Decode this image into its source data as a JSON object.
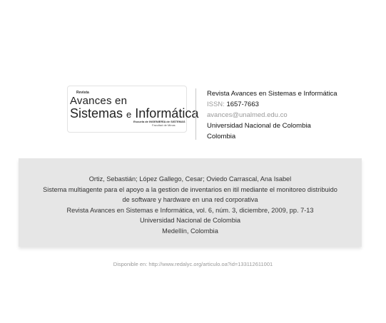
{
  "logo": {
    "small": "Revista",
    "line1": "Avances en",
    "line2_main": "Sistemas",
    "line2_e": "e",
    "line2_end": "Informática",
    "school": "Escuela de INGENIERÍA de SISTEMAS",
    "faculty": "Facultad de Minas"
  },
  "journal": {
    "name": "Revista Avances en Sistemas e Informática",
    "issn_label": "ISSN:",
    "issn": "1657-7663",
    "email": "avances@unalmed.edu.co",
    "institution": "Universidad Nacional de Colombia",
    "country": "Colombia"
  },
  "reference": {
    "authors": "Ortiz, Sebastián; López Gallego, Cesar; Oviedo Carrascal, Ana Isabel",
    "title_line1": "Sistema multiagente para el apoyo a la gestion de inventarios en itil mediante el monitoreo distribuido",
    "title_line2": "de software y hardware en una red corporativa",
    "citation": "Revista Avances en Sistemas e Informática, vol. 6, núm. 3, diciembre, 2009, pp. 7-13",
    "institution": "Universidad Nacional de Colombia",
    "city": "Medellín, Colombia"
  },
  "footer": {
    "available": "Disponible en: http://www.redalyc.org/articulo.oa?id=133112611001"
  }
}
